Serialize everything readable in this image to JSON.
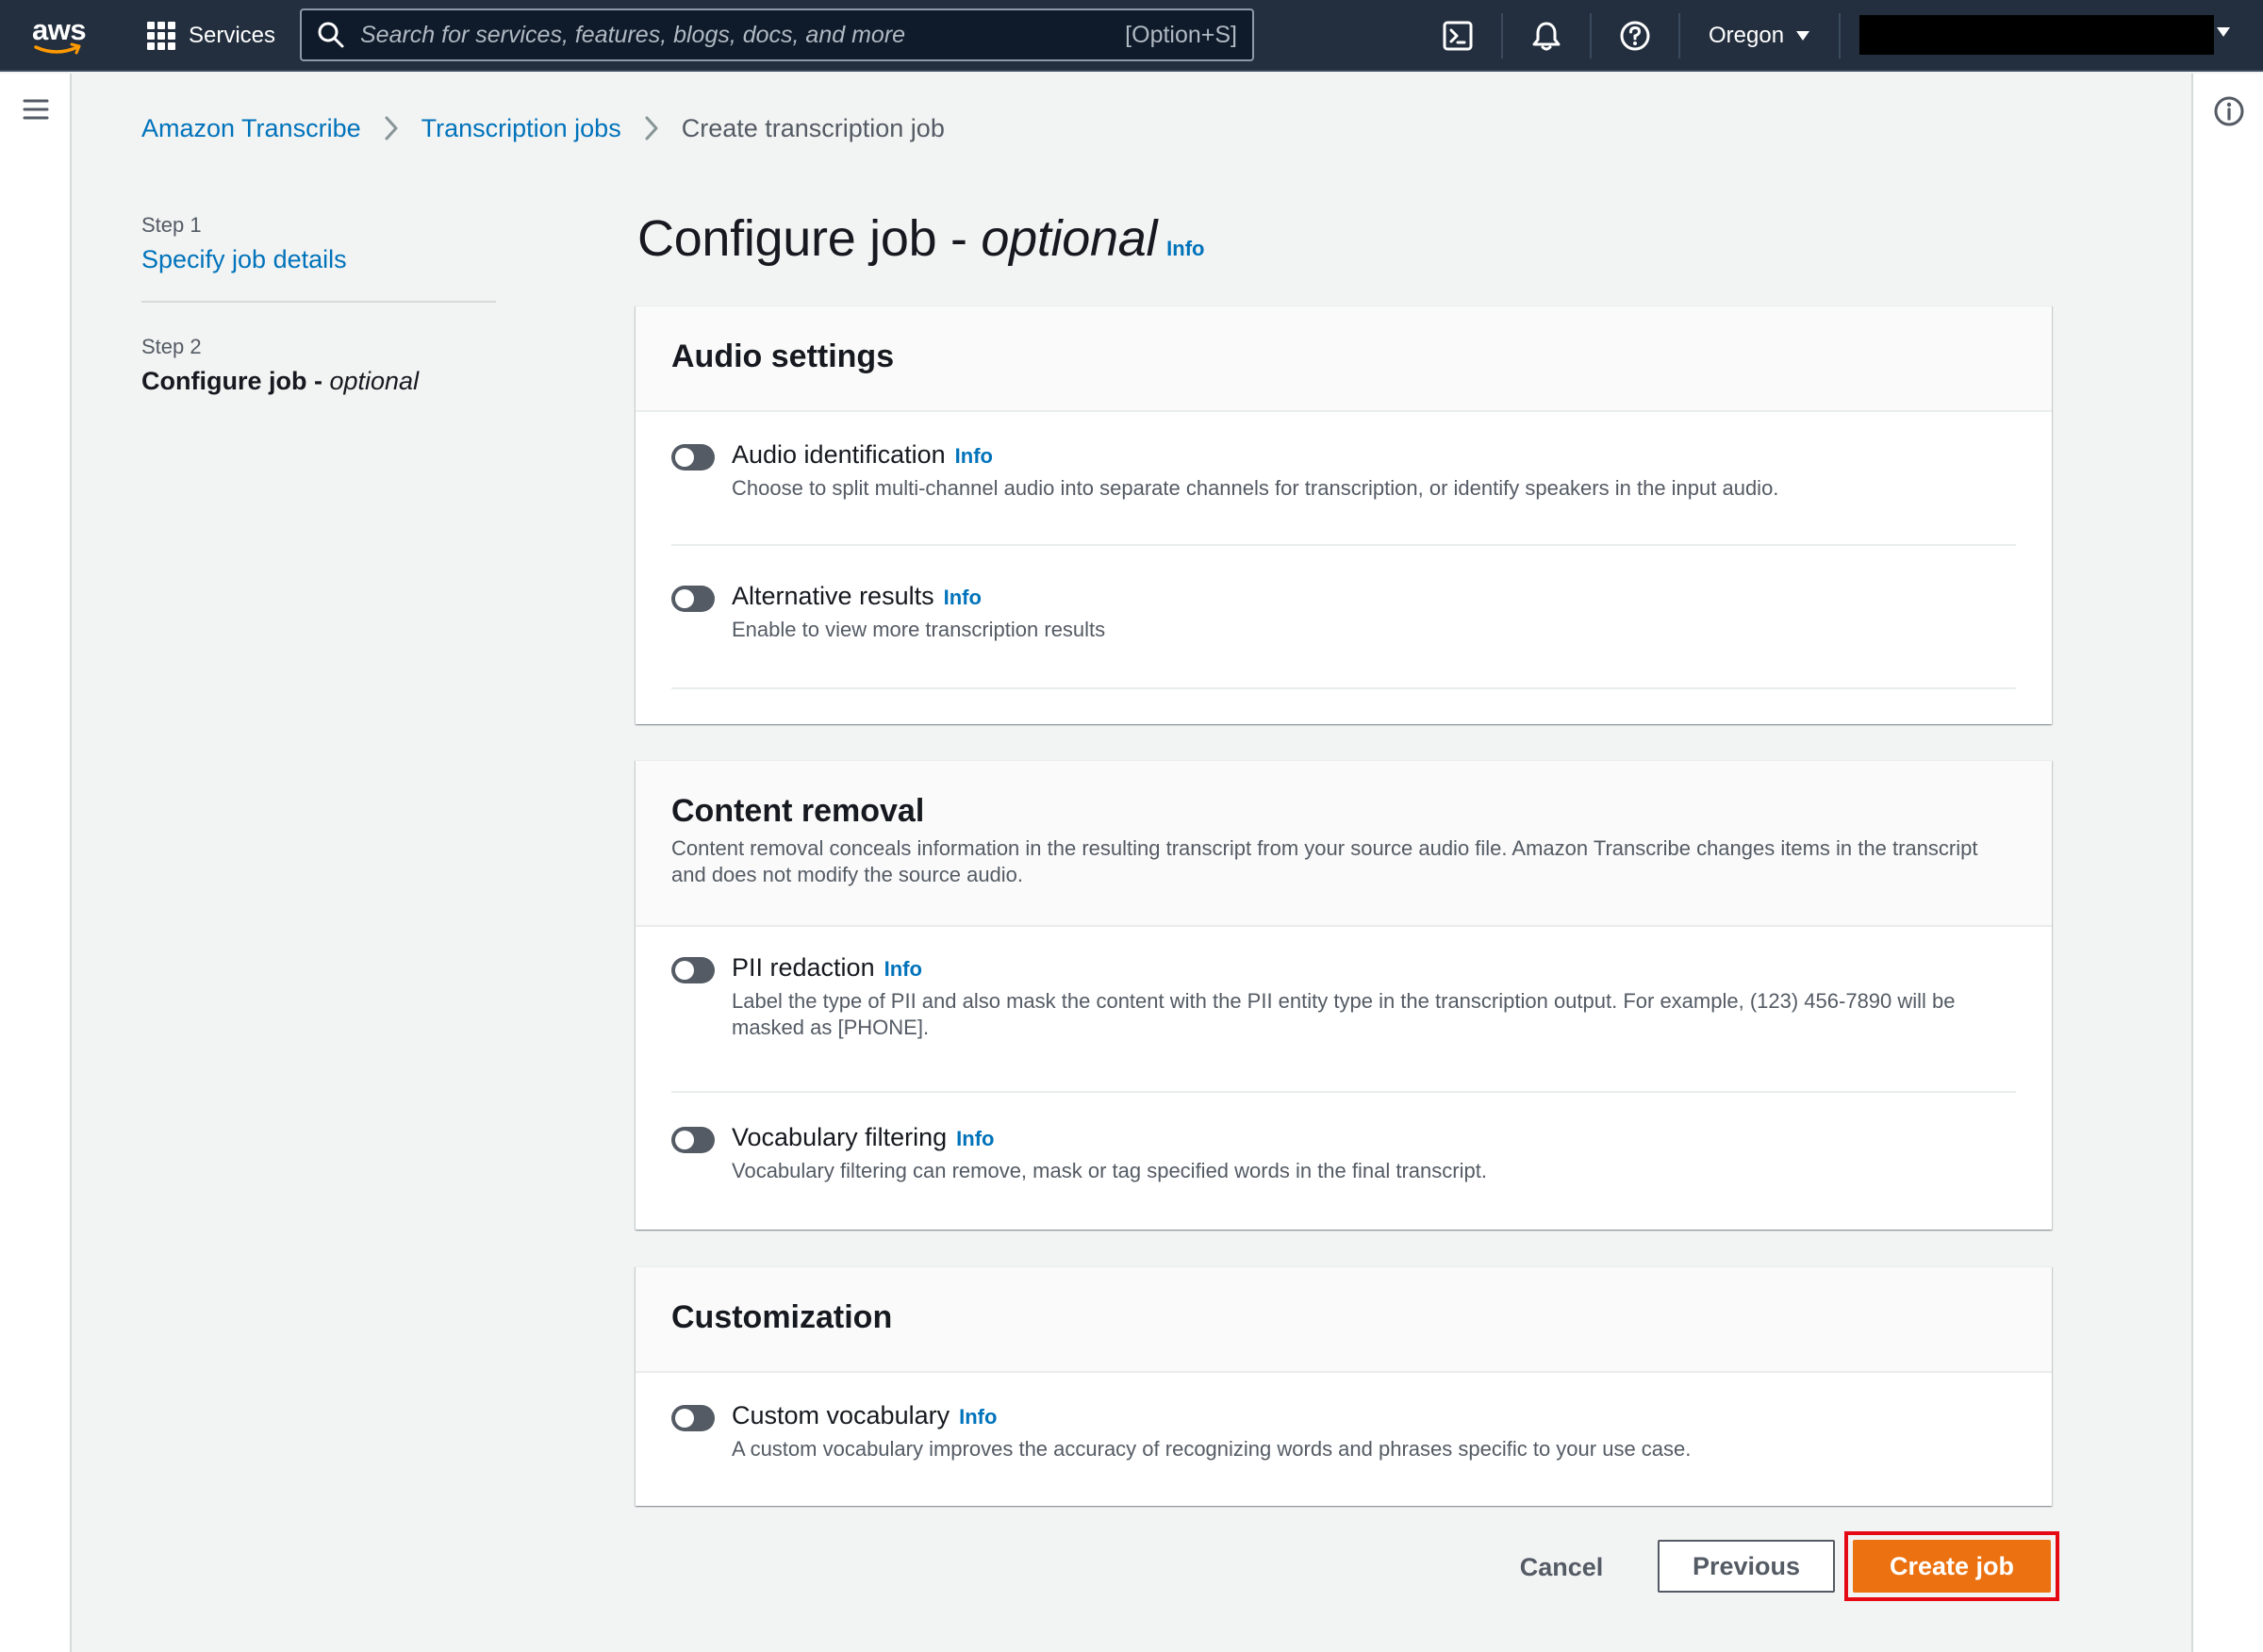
{
  "topnav": {
    "logo_text": "aws",
    "services_label": "Services",
    "search_placeholder": "Search for services, features, blogs, docs, and more",
    "search_shortcut": "[Option+S]",
    "region_label": "Oregon"
  },
  "breadcrumb": {
    "items": [
      "Amazon Transcribe",
      "Transcription jobs"
    ],
    "current": "Create transcription job"
  },
  "steps": {
    "step1": {
      "number": "Step 1",
      "label": "Specify job details"
    },
    "step2": {
      "number": "Step 2",
      "label": "Configure job",
      "separator": " - ",
      "label_suffix": "optional"
    }
  },
  "page": {
    "title": "Configure job - ",
    "title_suffix": "optional",
    "info": "Info"
  },
  "audio_settings": {
    "title": "Audio settings",
    "items": [
      {
        "label": "Audio identification",
        "info": "Info",
        "description": "Choose to split multi-channel audio into separate channels for transcription, or identify speakers in the input audio.",
        "enabled": false
      },
      {
        "label": "Alternative results",
        "info": "Info",
        "description": "Enable to view more transcription results",
        "enabled": false
      }
    ]
  },
  "content_removal": {
    "title": "Content removal",
    "description": "Content removal conceals information in the resulting transcript from your source audio file. Amazon Transcribe changes items in the transcript and does not modify the source audio.",
    "items": [
      {
        "label": "PII redaction",
        "info": "Info",
        "description": "Label the type of PII and also mask the content with the PII entity type in the transcription output. For example, (123) 456-7890 will be masked as [PHONE].",
        "enabled": false
      },
      {
        "label": "Vocabulary filtering",
        "info": "Info",
        "description": "Vocabulary filtering can remove, mask or tag specified words in the final transcript.",
        "enabled": false
      }
    ]
  },
  "customization": {
    "title": "Customization",
    "items": [
      {
        "label": "Custom vocabulary",
        "info": "Info",
        "description": "A custom vocabulary improves the accuracy of recognizing words and phrases specific to your use case.",
        "enabled": false
      }
    ]
  },
  "footer": {
    "cancel_label": "Cancel",
    "previous_label": "Previous",
    "create_label": "Create job"
  },
  "colors": {
    "nav_bg": "#232f3e",
    "link": "#0073bb",
    "primary_button": "#ec7211",
    "highlight": "#e50914",
    "toggle_off": "#545b64"
  },
  "icons": [
    "grid-icon",
    "search-icon",
    "cloudshell-icon",
    "bell-icon",
    "help-icon",
    "caret-down-icon",
    "menu-icon",
    "info-circle-icon",
    "chevron-right-icon"
  ]
}
